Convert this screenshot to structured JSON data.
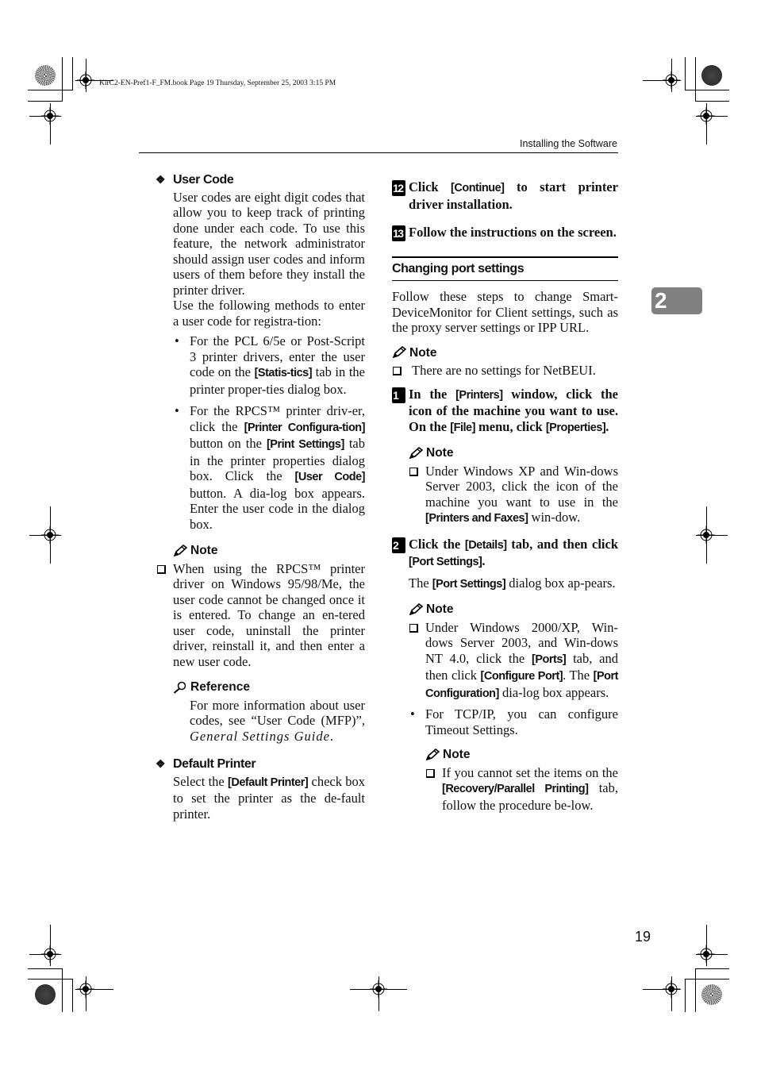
{
  "slug": "KirC2-EN-Pref1-F_FM.book  Page 19  Thursday, September 25, 2003  3:15 PM",
  "running_head": "Installing the Software",
  "chapter_tab": "2",
  "page_number": "19",
  "left_column": {
    "user_code": {
      "heading": "User Code",
      "para1": "User codes are eight digit codes that allow you to keep track of printing done under each code. To use this feature, the network administrator should assign user codes and inform users of them before they install the printer driver.",
      "para2": "Use the following methods to enter a user code for registra-tion:",
      "bullets": [
        {
          "pre": "For the PCL 6/5e or Post-Script 3 printer drivers, enter the user code on the ",
          "kw1": "[Statis-tics]",
          "post": " tab in the printer proper-ties dialog box."
        },
        {
          "pre": "For the RPCS™ printer driv-er, click the ",
          "kw1": "[Printer Configura-tion]",
          "mid1": " button on the ",
          "kw2": "[Print Settings]",
          "mid2": " tab in the printer properties dialog box. Click the ",
          "kw3": "[User Code]",
          "post": " button. A dia-log box appears. Enter the user code in the dialog box."
        }
      ],
      "note": {
        "label": "Note",
        "items": [
          "When using the RPCS™ printer driver on Windows 95/98/Me, the user code cannot be changed once it is entered. To change an en-tered user code, uninstall the printer driver, reinstall it, and then enter a new user code."
        ]
      },
      "reference": {
        "label": "Reference",
        "pre": "For more information about user codes, see “User Code (MFP)”, ",
        "italic": "General Settings Guide",
        "post": "."
      }
    },
    "default_printer": {
      "heading": "Default Printer",
      "pre": "Select the ",
      "kw": "[Default Printer]",
      "post": " check box to set the printer as the de-fault printer."
    }
  },
  "right_column": {
    "step12": {
      "num": "12",
      "pre": "Click ",
      "kw": "[Continue]",
      "post": " to start printer driver installation."
    },
    "step13": {
      "num": "13",
      "text": "Follow the instructions on the screen."
    },
    "procedure": {
      "heading": "Changing port settings",
      "intro": "Follow these steps to change Smart-DeviceMonitor for Client settings, such as the proxy server settings or IPP URL.",
      "note": {
        "label": "Note",
        "items": [
          "There are no settings for NetBEUI."
        ]
      },
      "step1": {
        "num": "1",
        "pre": "In the ",
        "kw1": "[Printers]",
        "mid": " window, click the icon of the machine you want to use. On the ",
        "kw2": "[File]",
        "mid2": " menu, click ",
        "kw3": "[Properties]",
        "post": ".",
        "note": {
          "label": "Note",
          "pre": "Under Windows XP and Win-dows Server 2003, click the icon of the machine you want to use in the ",
          "kw": "[Printers and Faxes]",
          "post": " win-dow."
        }
      },
      "step2": {
        "num": "2",
        "pre": "Click the ",
        "kw1": "[Details]",
        "mid": " tab, and then click ",
        "kw2": "[Port Settings]",
        "post": ".",
        "result_pre": "The ",
        "result_kw": "[Port Settings]",
        "result_post": " dialog box ap-pears.",
        "note": {
          "label": "Note",
          "pre": "Under Windows 2000/XP, Win-dows Server 2003, and Win-dows NT 4.0, click the ",
          "kw1": "[Ports]",
          "mid1": " tab, and then click ",
          "kw2": "[Configure Port]",
          "mid2": ". The ",
          "kw3": "[Port Configuration]",
          "post": " dia-log box appears.",
          "bullet": "For TCP/IP, you can configure Timeout Settings.",
          "subnote": {
            "label": "Note",
            "pre": "If you cannot set the items on the ",
            "kw": "[Recovery/Parallel Printing]",
            "post": " tab, follow the procedure be-low."
          }
        }
      }
    }
  }
}
